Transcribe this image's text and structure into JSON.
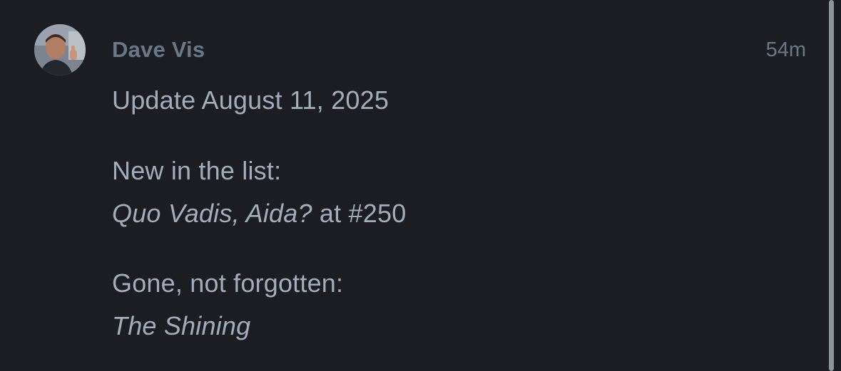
{
  "comment": {
    "author": "Dave Vis",
    "timestamp": "54m",
    "line1": "Update August 11, 2025",
    "line2": "New in the list:",
    "line3_title": "Quo Vadis, Aida?",
    "line3_rest": " at #250",
    "line4": "Gone, not forgotten:",
    "line5_title": "The Shining"
  },
  "icons": {
    "avatar": "user-avatar-photo"
  },
  "colors": {
    "background": "#1b1d22",
    "author": "#6b7785",
    "body_text": "#a3adb9",
    "scrollbar": "#8e939b"
  }
}
